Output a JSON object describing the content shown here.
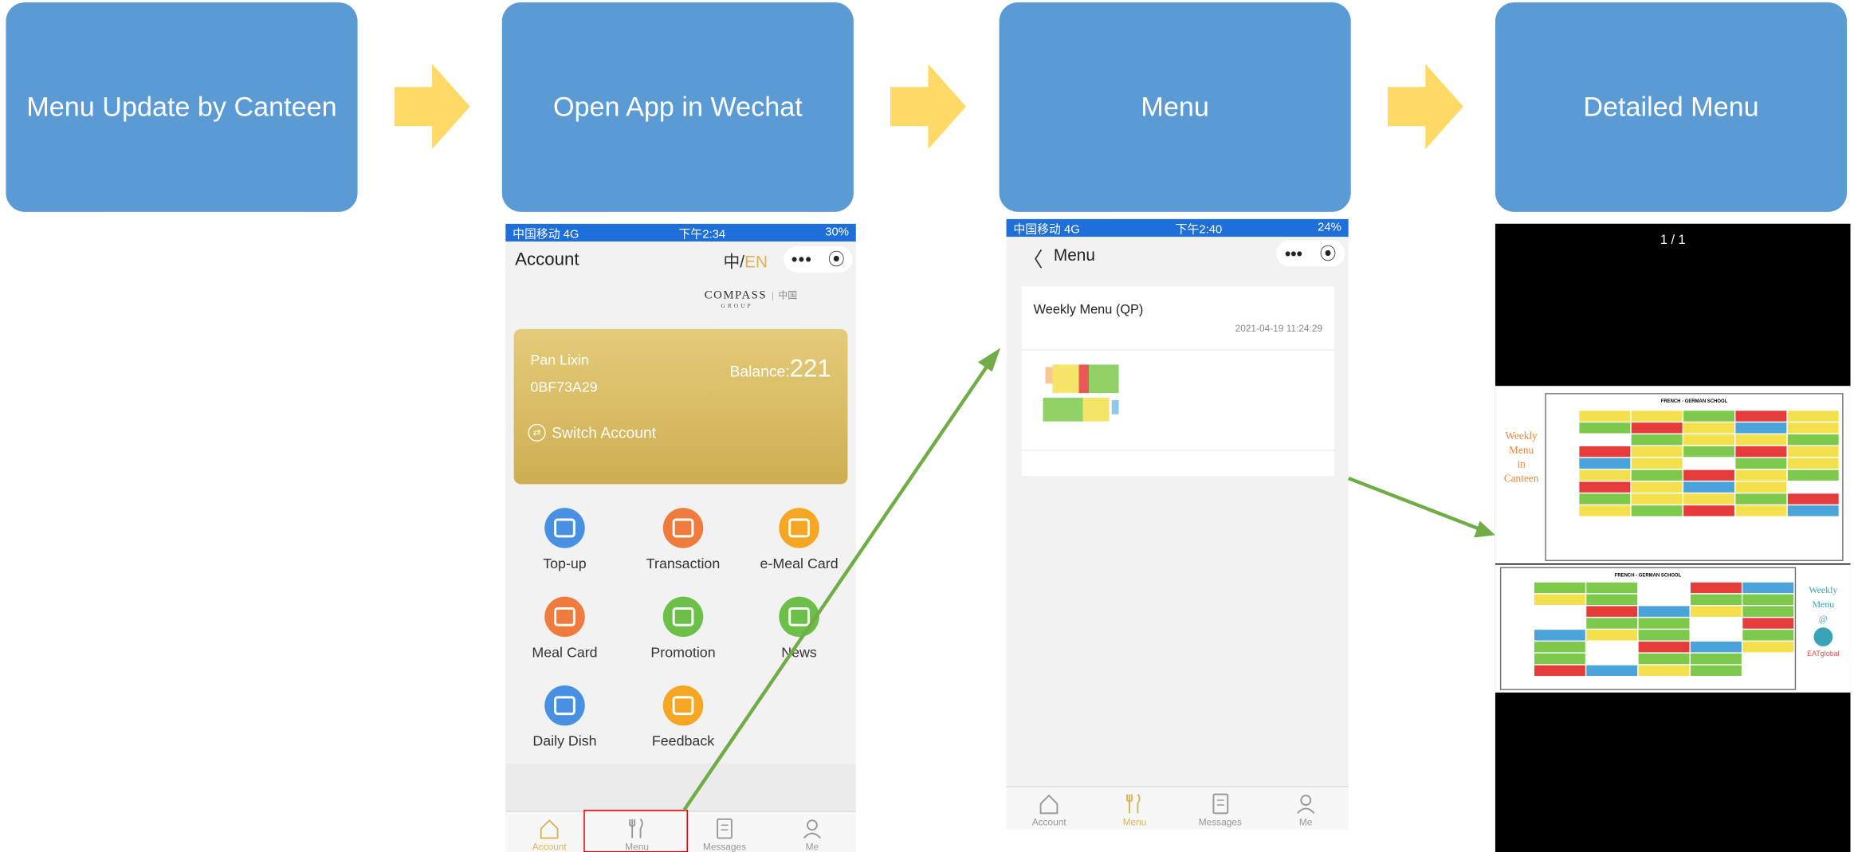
{
  "steps": [
    {
      "label": "Menu Update by Canteen"
    },
    {
      "label": "Open App in Wechat"
    },
    {
      "label": "Menu"
    },
    {
      "label": "Detailed Menu"
    }
  ],
  "colors": {
    "step_box": "#5b9bd5",
    "step_arrow": "#ffd966",
    "flow_arrow": "#70ad47",
    "highlight": "#e00000",
    "status_bar": "#1e6fd9",
    "card_gold": "#d6b85a"
  },
  "phone1": {
    "status": {
      "carrier": "中国移动 4G",
      "time": "下午2:34",
      "battery": "30%"
    },
    "title": "Account",
    "lang_zh": "中/",
    "lang_en": "EN",
    "logo_text": "COMPASS",
    "logo_sub": "GROUP",
    "logo_cn": "中国",
    "card": {
      "name": "Pan Lixin",
      "id": "0BF73A29",
      "balance_label": "Balance:",
      "balance_value": "221",
      "switch_label": "Switch Account"
    },
    "grid": [
      {
        "label": "Top-up",
        "icon": "topup-icon",
        "color": "#4a90e2"
      },
      {
        "label": "Transaction",
        "icon": "transaction-icon",
        "color": "#f07b3f"
      },
      {
        "label": "e-Meal Card",
        "icon": "qr-code-icon",
        "color": "#f5a623"
      },
      {
        "label": "Meal Card",
        "icon": "card-icon",
        "color": "#f07b3f"
      },
      {
        "label": "Promotion",
        "icon": "gift-icon",
        "color": "#6cc04a"
      },
      {
        "label": "News",
        "icon": "megaphone-icon",
        "color": "#6cc04a"
      },
      {
        "label": "Daily Dish",
        "icon": "cloche-icon",
        "color": "#4a90e2"
      },
      {
        "label": "Feedback",
        "icon": "feedback-icon",
        "color": "#f5a623"
      }
    ],
    "tabs": [
      "Account",
      "Menu",
      "Messages",
      "Me"
    ]
  },
  "phone2": {
    "status": {
      "carrier": "中国移动 4G",
      "time": "下午2:40",
      "battery": "24%"
    },
    "title": "Menu",
    "item_title": "Weekly Menu (QP)",
    "item_date": "2021-04-19 11:24:29",
    "tabs": [
      "Account",
      "Menu",
      "Messages",
      "Me"
    ]
  },
  "viewer": {
    "page_counter": "1 / 1",
    "header_title": "FRENCH - GERMAN SCHOOL",
    "side_left": [
      "Weekly",
      "Menu",
      "in",
      "Canteen"
    ],
    "side_right": [
      "Weekly",
      "Menu",
      "@"
    ],
    "brand": "EATglobal"
  }
}
